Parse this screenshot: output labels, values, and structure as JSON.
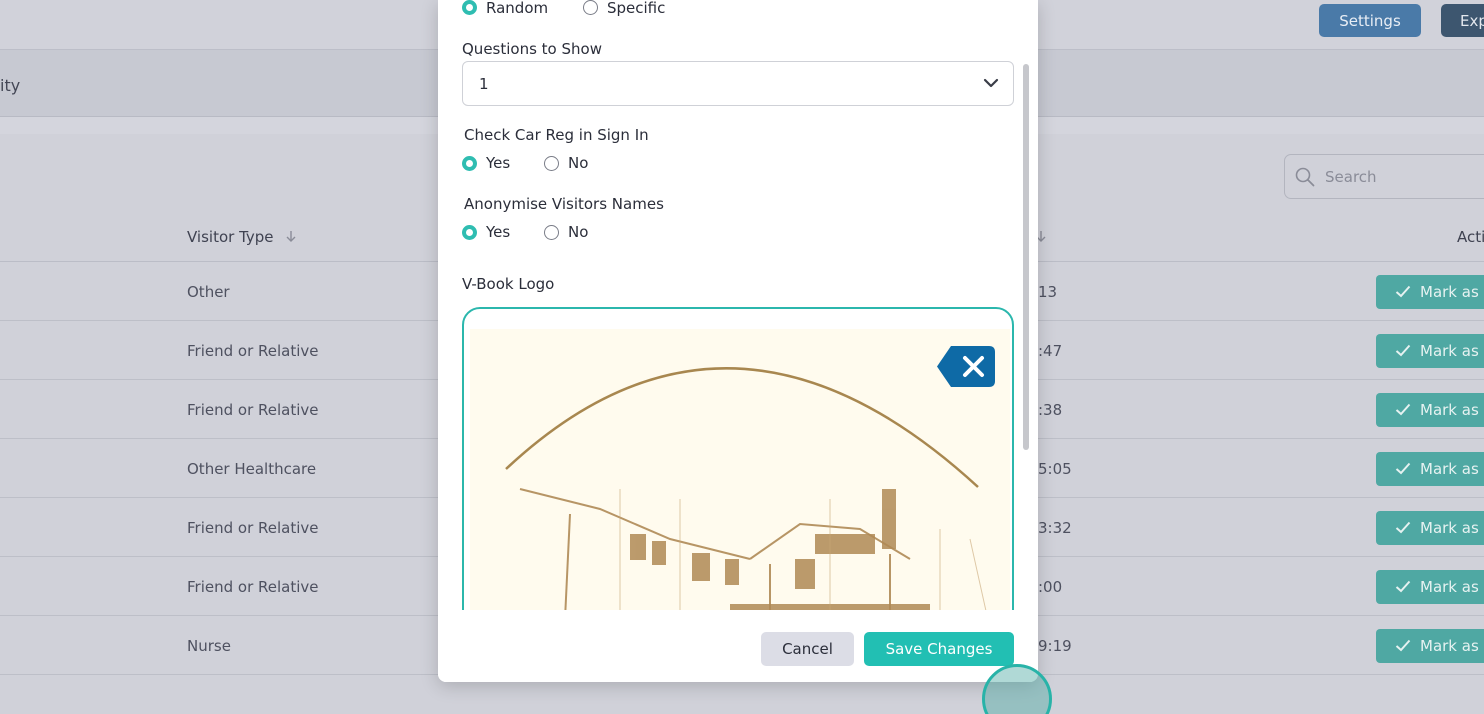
{
  "header": {
    "settings_label": "Settings",
    "export_label": "Exp"
  },
  "subheader": {
    "text": "ity"
  },
  "search": {
    "placeholder": "Search"
  },
  "table": {
    "col_visitor_type": "Visitor Type",
    "col_actions": "Acti",
    "rows": [
      {
        "visitor_type": "Other",
        "time": "13",
        "action": "Mark as"
      },
      {
        "visitor_type": "Friend or Relative",
        "time": ":47",
        "action": "Mark as"
      },
      {
        "visitor_type": "Friend or Relative",
        "time": ":38",
        "action": "Mark as"
      },
      {
        "visitor_type": "Other Healthcare",
        "time": "5:05",
        "action": "Mark as"
      },
      {
        "visitor_type": "Friend or Relative",
        "time": "3:32",
        "action": "Mark as"
      },
      {
        "visitor_type": "Friend or Relative",
        "time": ":00",
        "action": "Mark as"
      },
      {
        "visitor_type": "Nurse",
        "time": "9:19",
        "action": "Mark as"
      }
    ]
  },
  "modal": {
    "question_mode": {
      "option_random": "Random",
      "option_specific": "Specific",
      "selected": "Random"
    },
    "questions_to_show": {
      "label": "Questions to Show",
      "value": "1"
    },
    "check_car_reg": {
      "label": "Check Car Reg in Sign In",
      "option_yes": "Yes",
      "option_no": "No",
      "selected": "Yes"
    },
    "anonymise": {
      "label": "Anonymise Visitors Names",
      "option_yes": "Yes",
      "option_no": "No",
      "selected": "Yes"
    },
    "logo": {
      "label": "V-Book Logo"
    },
    "cancel_label": "Cancel",
    "save_label": "Save Changes"
  },
  "colors": {
    "accent": "#22bfb3",
    "settings_button": "#4a7aa8",
    "mark_button": "#4fa8a3",
    "remove_button": "#0e6aa6"
  }
}
